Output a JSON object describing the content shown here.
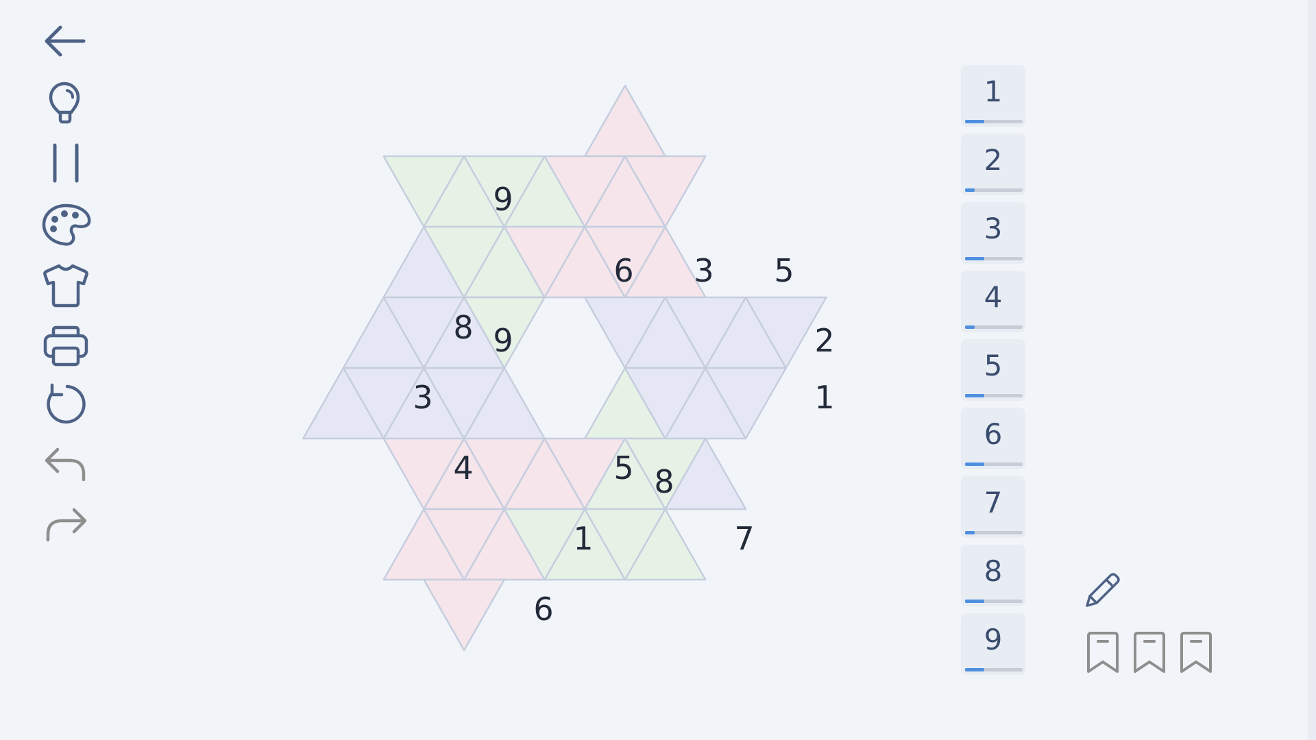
{
  "toolbar": {
    "items": [
      {
        "name": "back-arrow-icon"
      },
      {
        "name": "lightbulb-hint-icon"
      },
      {
        "name": "pause-icon"
      },
      {
        "name": "palette-icon"
      },
      {
        "name": "shirt-icon"
      },
      {
        "name": "printer-icon"
      },
      {
        "name": "restart-icon"
      },
      {
        "name": "undo-icon"
      },
      {
        "name": "redo-icon"
      }
    ]
  },
  "colors": {
    "green": "#e7f2e7",
    "pink": "#f6e5ea",
    "lavender": "#e5e8f4",
    "grid_line": "#c5cede",
    "accent": "#4f8fe0",
    "icon": "#4d6285",
    "icon_disabled": "#8e8e8e"
  },
  "board": {
    "givens": [
      {
        "id": "g1",
        "value": "9"
      },
      {
        "id": "g2",
        "value": "6"
      },
      {
        "id": "g3",
        "value": "3"
      },
      {
        "id": "g4",
        "value": "5"
      },
      {
        "id": "g5",
        "value": "8"
      },
      {
        "id": "g6",
        "value": "9"
      },
      {
        "id": "g7",
        "value": "2"
      },
      {
        "id": "g8",
        "value": "3"
      },
      {
        "id": "g9",
        "value": "1"
      },
      {
        "id": "g10",
        "value": "4"
      },
      {
        "id": "g11",
        "value": "5"
      },
      {
        "id": "g12",
        "value": "8"
      },
      {
        "id": "g13",
        "value": "1"
      },
      {
        "id": "g14",
        "value": "7"
      },
      {
        "id": "g15",
        "value": "6"
      }
    ]
  },
  "number_picker": {
    "buttons": [
      {
        "label": "1",
        "progress": 0.33
      },
      {
        "label": "2",
        "progress": 0.17
      },
      {
        "label": "3",
        "progress": 0.33
      },
      {
        "label": "4",
        "progress": 0.17
      },
      {
        "label": "5",
        "progress": 0.33
      },
      {
        "label": "6",
        "progress": 0.33
      },
      {
        "label": "7",
        "progress": 0.17
      },
      {
        "label": "8",
        "progress": 0.33
      },
      {
        "label": "9",
        "progress": 0.33
      }
    ]
  },
  "notes": {
    "pencil_icon": "pencil-icon",
    "bookmark_icon": "bookmark-icon",
    "bookmark_count": 3
  }
}
